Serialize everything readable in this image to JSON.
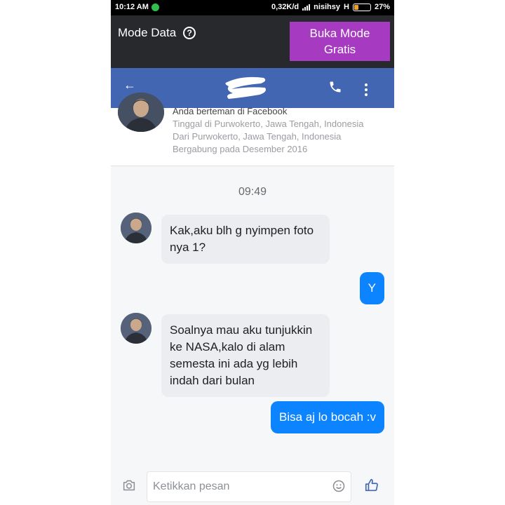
{
  "status_bar": {
    "time": "10:12 AM",
    "speed": "0,32K/d",
    "carrier": "nisihsy",
    "network": "H",
    "battery": "27%",
    "battery_level": 0.27
  },
  "data_mode": {
    "label": "Mode Data",
    "help_glyph": "?",
    "button_label": "Buka Mode\nGratis",
    "button_color": "#a63ac0"
  },
  "header": {
    "back_glyph": "←",
    "accent": "#4266b2"
  },
  "profile": {
    "friend_line": "Anda berteman di Facebook",
    "lives_in": "Tinggal di Purwokerto, Jawa Tengah, Indonesia",
    "from": "Dari Purwokerto, Jawa Tengah, Indonesia",
    "joined": "Bergabung pada Desember 2016"
  },
  "conversation": {
    "timestamp": "09:49",
    "messages": [
      {
        "from": "them",
        "text": "Kak,aku blh g nyimpen foto nya 1?"
      },
      {
        "from": "me",
        "text": "Y"
      },
      {
        "from": "them",
        "text": "Soalnya mau aku tunjukkin ke NASA,kalo di alam semesta ini ada yg lebih indah dari bulan"
      },
      {
        "from": "me",
        "text": "Bisa aj lo bocah :v"
      }
    ],
    "outgoing_color": "#0d84ff",
    "incoming_color": "#ebedf0"
  },
  "composer": {
    "placeholder": "Ketikkan pesan",
    "value": ""
  },
  "icons": {
    "camera": "camera-icon",
    "emoji": "emoji-icon",
    "like": "like-icon",
    "call": "phone-icon",
    "more": "more-vertical-icon"
  }
}
